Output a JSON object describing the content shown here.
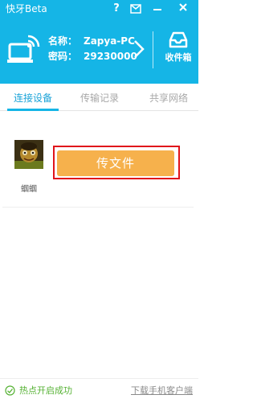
{
  "window": {
    "title": "快牙Beta",
    "controls": {
      "help_icon": "help-icon",
      "mail_icon": "mail-icon",
      "minimize_icon": "minimize-icon",
      "close_icon": "close-icon"
    }
  },
  "header": {
    "name_label": "名称：",
    "name_value": "Zapya-PC",
    "password_label": "密码：",
    "password_value": "29230000",
    "inbox_label": "收件箱",
    "accent_color": "#15b5e6"
  },
  "tabs": [
    {
      "label": "连接设备",
      "active": true
    },
    {
      "label": "传输记录",
      "active": false
    },
    {
      "label": "共享网络",
      "active": false
    }
  ],
  "device": {
    "name": "蝈蝈",
    "send_label": "传文件",
    "send_color": "#f6b14c",
    "highlight_color": "#e0141b"
  },
  "footer": {
    "status_text": "热点开启成功",
    "status_color": "#56b234",
    "download_link": "下载手机客户端"
  }
}
